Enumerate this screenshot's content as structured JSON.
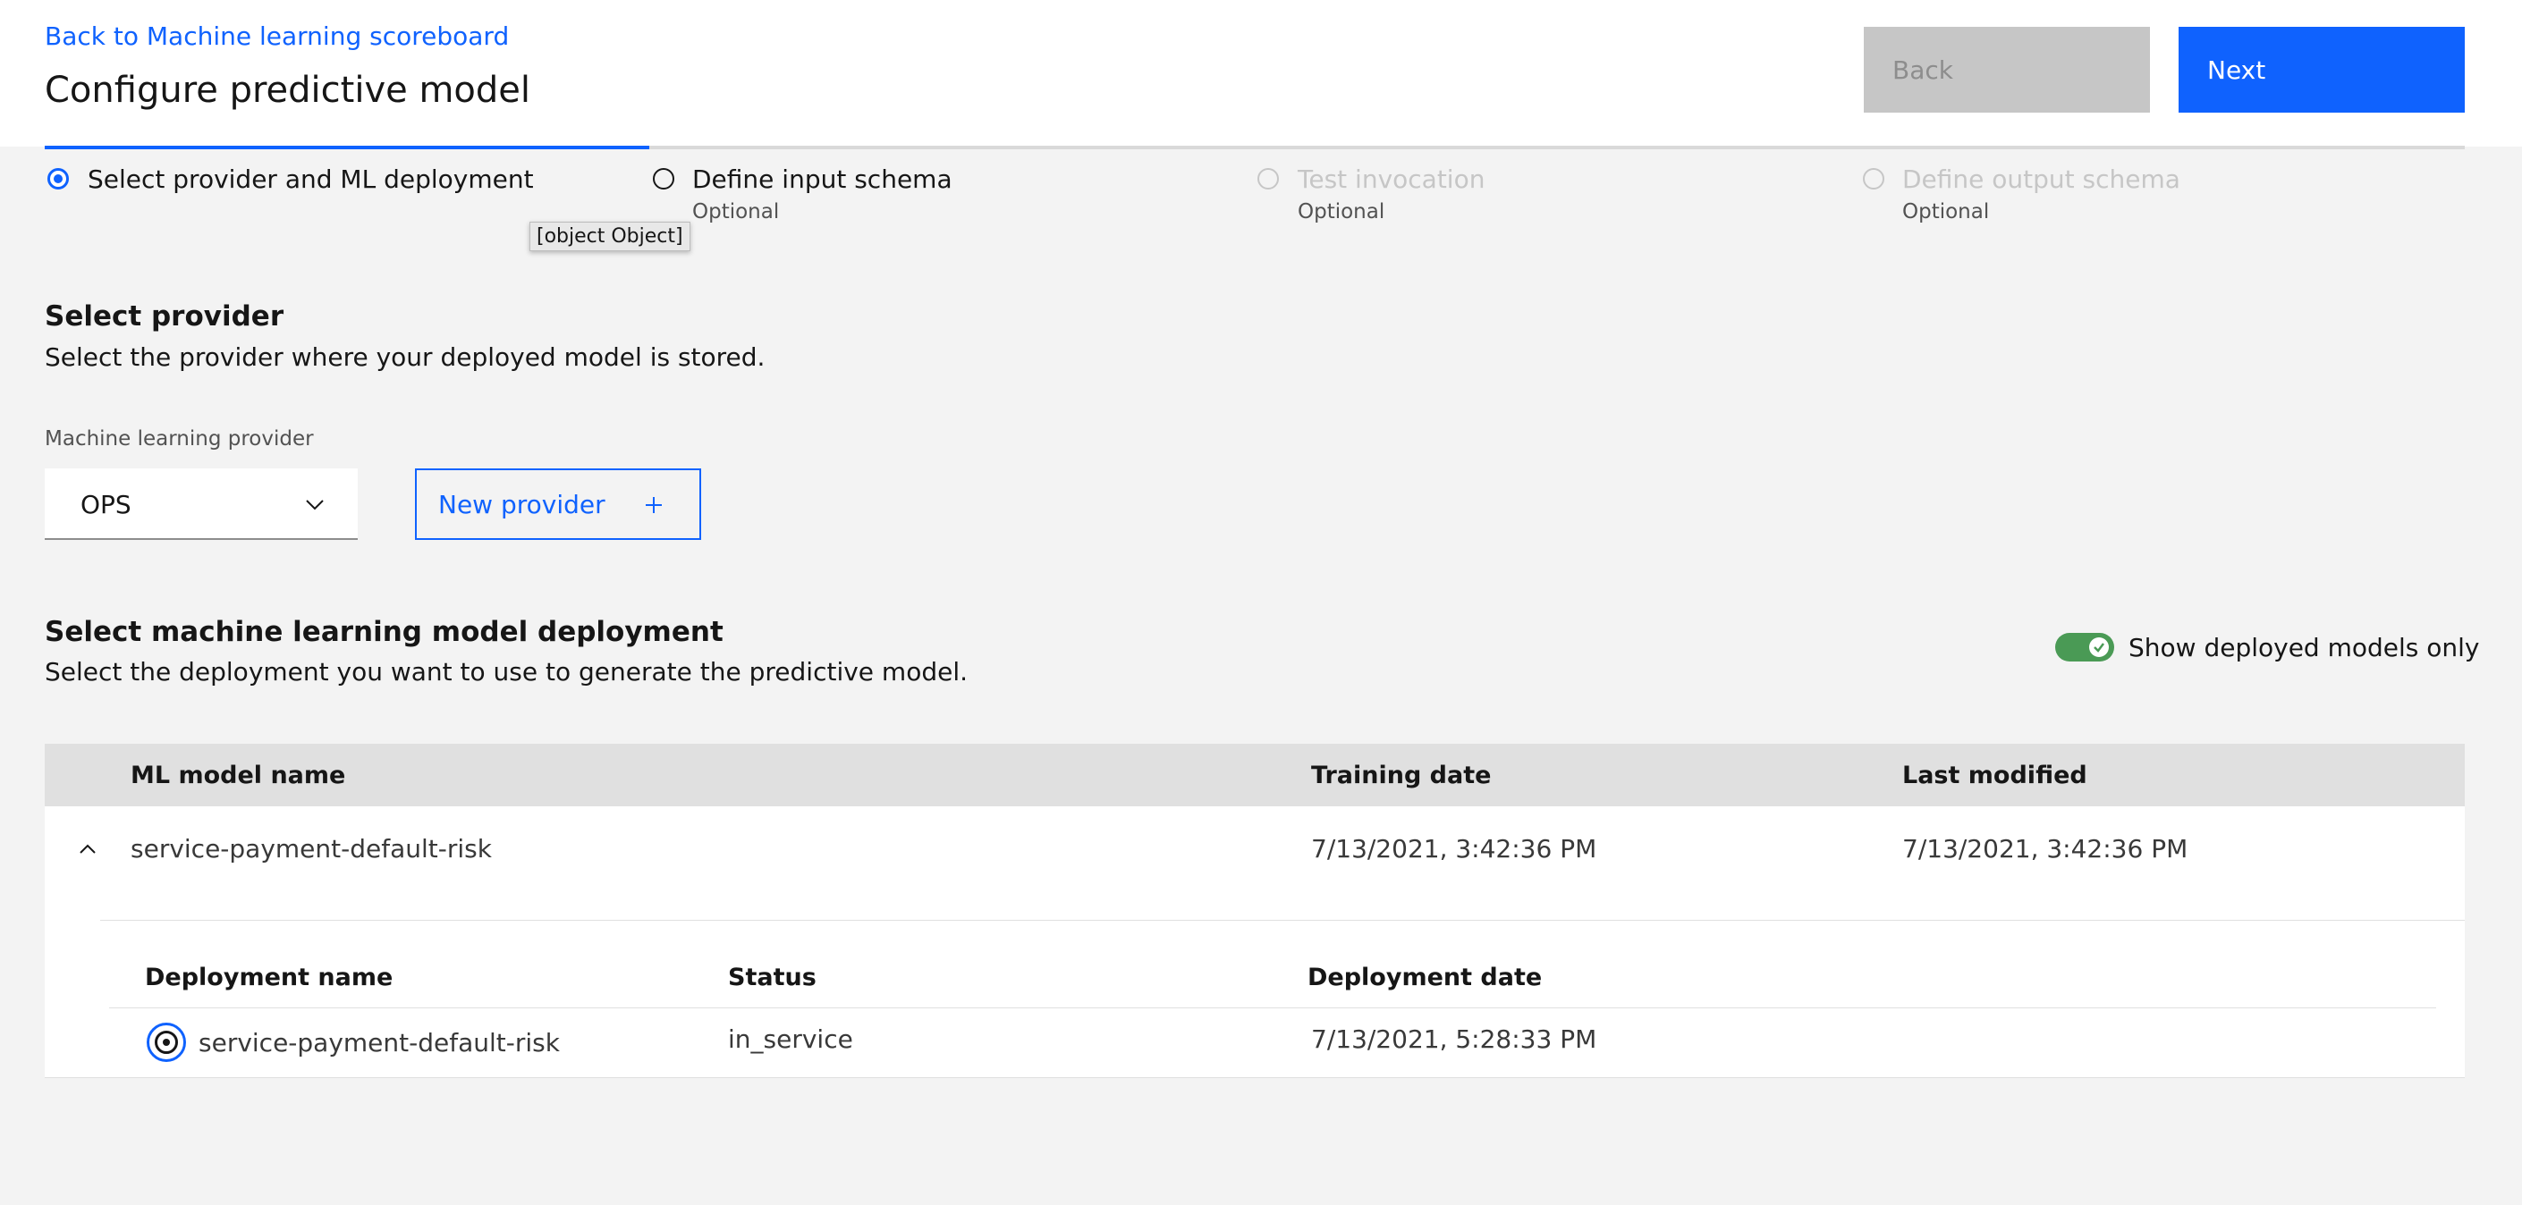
{
  "header": {
    "back_link": "Back to Machine learning scoreboard",
    "title": "Configure predictive model",
    "back_button": "Back",
    "next_button": "Next"
  },
  "progress": {
    "steps": [
      {
        "label": "Select provider and ML deployment",
        "optional": "",
        "state": "current"
      },
      {
        "label": "Define input schema",
        "optional": "Optional",
        "state": "incomplete"
      },
      {
        "label": "Test invocation",
        "optional": "Optional",
        "state": "disabled"
      },
      {
        "label": "Define output schema",
        "optional": "Optional",
        "state": "disabled"
      }
    ],
    "tooltip": "[object Object]"
  },
  "provider_section": {
    "title": "Select provider",
    "description": "Select the provider where your deployed model is stored.",
    "field_label": "Machine learning provider",
    "selected_provider": "OPS",
    "new_provider_button": "New provider"
  },
  "deployment_section": {
    "title": "Select machine learning model deployment",
    "description": "Select the deployment you want to use to generate the predictive model.",
    "toggle_label": "Show deployed models only",
    "toggle_on": true
  },
  "models_table": {
    "columns": [
      "ML model name",
      "Training date",
      "Last modified"
    ],
    "rows": [
      {
        "name": "service-payment-default-risk",
        "training_date": "7/13/2021, 3:42:36 PM",
        "last_modified": "7/13/2021, 3:42:36 PM",
        "expanded": true
      }
    ]
  },
  "deployments_table": {
    "columns": [
      "Deployment name",
      "Status",
      "Deployment date"
    ],
    "rows": [
      {
        "name": "service-payment-default-risk",
        "status": "in_service",
        "deployment_date": "7/13/2021, 5:28:33 PM",
        "selected": true
      }
    ]
  },
  "colors": {
    "accent": "#0f62fe",
    "toggle_on": "#4a9a55",
    "header_bg": "#ffffff",
    "page_bg": "#f3f3f3",
    "table_header_bg": "#e0e0e0"
  }
}
